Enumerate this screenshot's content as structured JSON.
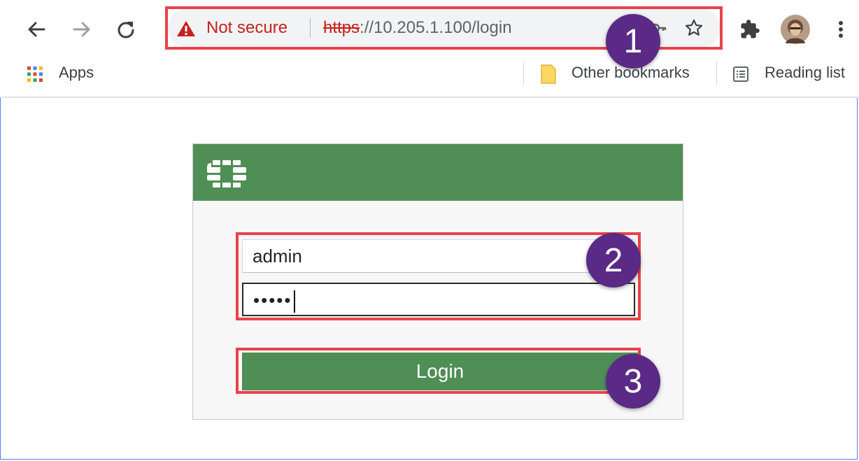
{
  "browser": {
    "security_label": "Not secure",
    "url_protocol": "https",
    "url_rest": "://10.205.1.100/login",
    "bookmarks": {
      "apps_label": "Apps",
      "other_bookmarks_label": "Other bookmarks",
      "reading_list_label": "Reading list"
    }
  },
  "login": {
    "username_value": "admin",
    "password_masked": "•••••",
    "login_label": "Login",
    "header_color": "#4f8e55"
  },
  "annotations": {
    "callouts": [
      "1",
      "2",
      "3"
    ],
    "highlight_color": "#e8434b",
    "badge_color": "#5a2a86"
  },
  "icons": [
    "back-arrow-icon",
    "forward-arrow-icon",
    "reload-icon",
    "warning-triangle-icon",
    "key-icon",
    "star-icon",
    "extensions-puzzle-icon",
    "profile-avatar",
    "kebab-menu-icon",
    "apps-grid-icon",
    "folder-icon",
    "reading-list-icon",
    "fortinet-logo"
  ]
}
